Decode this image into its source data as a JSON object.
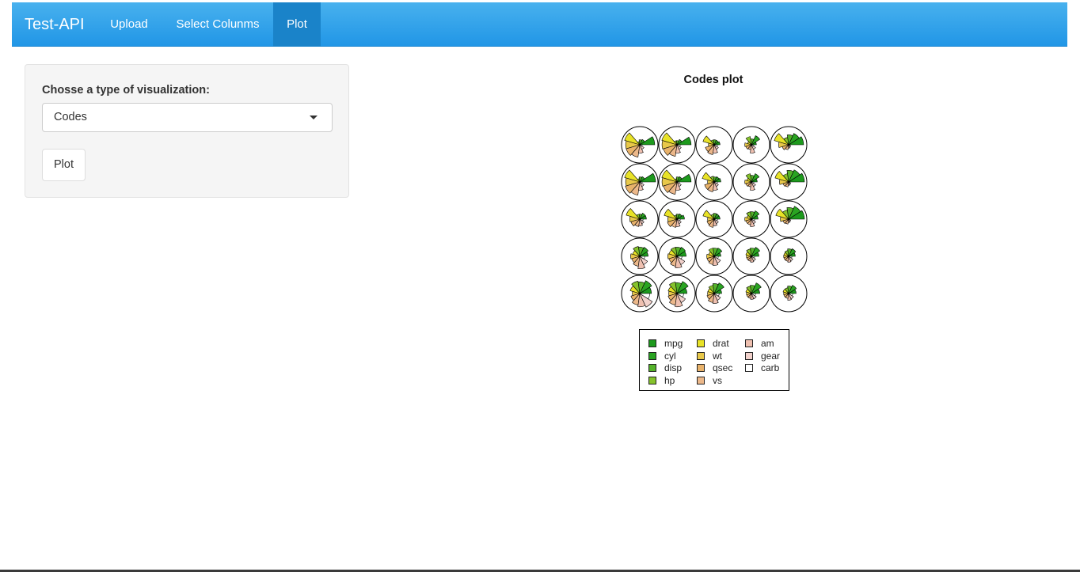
{
  "navbar": {
    "brand": "Test-API",
    "items": [
      {
        "label": "Upload"
      },
      {
        "label": "Select Colunms"
      },
      {
        "label": "Plot",
        "active": true
      }
    ]
  },
  "sidebar": {
    "select_label": "Chosse a type of visualization:",
    "select_value": "Codes",
    "plot_button": "Plot"
  },
  "chart_data": {
    "type": "segments",
    "title": "Codes plot",
    "variables": [
      "mpg",
      "cyl",
      "disp",
      "hp",
      "drat",
      "wt",
      "qsec",
      "vs",
      "am",
      "gear",
      "carb"
    ],
    "colors": [
      "#1d9a1d",
      "#2aa422",
      "#55b32a",
      "#86c32c",
      "#e8e227",
      "#e8c84a",
      "#e8b26b",
      "#ecb88a",
      "#efc0b0",
      "#f2d2cc",
      "#ffffff"
    ],
    "legend": {
      "columns": [
        [
          "mpg",
          "cyl",
          "disp",
          "hp"
        ],
        [
          "drat",
          "wt",
          "qsec",
          "vs"
        ],
        [
          "am",
          "gear",
          "carb"
        ]
      ]
    },
    "grid": {
      "rows": 5,
      "cols": 5
    },
    "segments": [
      [
        0.9,
        0.35,
        0.3,
        0.2,
        0.95,
        0.85,
        0.85,
        0.75,
        0.5,
        0.3,
        0.15
      ],
      [
        0.85,
        0.35,
        0.25,
        0.25,
        0.95,
        0.9,
        0.85,
        0.7,
        0.5,
        0.3,
        0.2
      ],
      [
        0.35,
        0.3,
        0.3,
        0.3,
        0.7,
        0.35,
        0.55,
        0.6,
        0.5,
        0.3,
        0.2
      ],
      [
        0.3,
        0.6,
        0.35,
        0.5,
        0.25,
        0.4,
        0.35,
        0.3,
        0.5,
        0.3,
        0.15
      ],
      [
        0.9,
        0.75,
        0.6,
        0.45,
        0.9,
        0.6,
        0.4,
        0.3,
        0.2,
        0.15,
        0.1
      ],
      [
        0.95,
        0.35,
        0.3,
        0.2,
        0.95,
        0.85,
        0.9,
        0.8,
        0.5,
        0.3,
        0.15
      ],
      [
        0.85,
        0.35,
        0.3,
        0.2,
        0.95,
        0.9,
        0.85,
        0.75,
        0.5,
        0.3,
        0.15
      ],
      [
        0.4,
        0.35,
        0.3,
        0.35,
        0.75,
        0.4,
        0.6,
        0.6,
        0.5,
        0.3,
        0.2
      ],
      [
        0.35,
        0.55,
        0.4,
        0.5,
        0.3,
        0.4,
        0.35,
        0.3,
        0.5,
        0.3,
        0.15
      ],
      [
        0.95,
        0.8,
        0.7,
        0.5,
        0.85,
        0.55,
        0.35,
        0.3,
        0.2,
        0.15,
        0.1
      ],
      [
        0.4,
        0.4,
        0.3,
        0.3,
        0.85,
        0.6,
        0.55,
        0.45,
        0.4,
        0.3,
        0.2
      ],
      [
        0.45,
        0.35,
        0.3,
        0.25,
        0.8,
        0.55,
        0.6,
        0.5,
        0.45,
        0.3,
        0.2
      ],
      [
        0.35,
        0.35,
        0.35,
        0.3,
        0.7,
        0.4,
        0.45,
        0.5,
        0.4,
        0.3,
        0.2
      ],
      [
        0.4,
        0.55,
        0.45,
        0.45,
        0.3,
        0.4,
        0.35,
        0.35,
        0.45,
        0.3,
        0.2
      ],
      [
        0.95,
        0.85,
        0.7,
        0.55,
        0.8,
        0.5,
        0.35,
        0.3,
        0.2,
        0.15,
        0.1
      ],
      [
        0.5,
        0.6,
        0.55,
        0.6,
        0.45,
        0.55,
        0.5,
        0.6,
        0.75,
        0.55,
        0.3
      ],
      [
        0.55,
        0.6,
        0.55,
        0.55,
        0.5,
        0.55,
        0.5,
        0.6,
        0.7,
        0.55,
        0.3
      ],
      [
        0.4,
        0.55,
        0.5,
        0.5,
        0.35,
        0.45,
        0.45,
        0.5,
        0.55,
        0.45,
        0.25
      ],
      [
        0.45,
        0.6,
        0.5,
        0.45,
        0.35,
        0.3,
        0.3,
        0.3,
        0.35,
        0.3,
        0.2
      ],
      [
        0.4,
        0.5,
        0.45,
        0.35,
        0.3,
        0.3,
        0.3,
        0.3,
        0.35,
        0.3,
        0.2
      ],
      [
        0.7,
        0.85,
        0.7,
        0.75,
        0.6,
        0.45,
        0.55,
        0.7,
        0.8,
        0.9,
        0.6
      ],
      [
        0.6,
        0.8,
        0.65,
        0.7,
        0.55,
        0.5,
        0.55,
        0.7,
        0.8,
        0.6,
        0.4
      ],
      [
        0.45,
        0.7,
        0.6,
        0.5,
        0.4,
        0.4,
        0.45,
        0.55,
        0.6,
        0.45,
        0.3
      ],
      [
        0.5,
        0.7,
        0.5,
        0.45,
        0.35,
        0.3,
        0.3,
        0.3,
        0.35,
        0.35,
        0.25
      ],
      [
        0.45,
        0.55,
        0.45,
        0.35,
        0.35,
        0.3,
        0.3,
        0.3,
        0.4,
        0.35,
        0.25
      ]
    ]
  }
}
